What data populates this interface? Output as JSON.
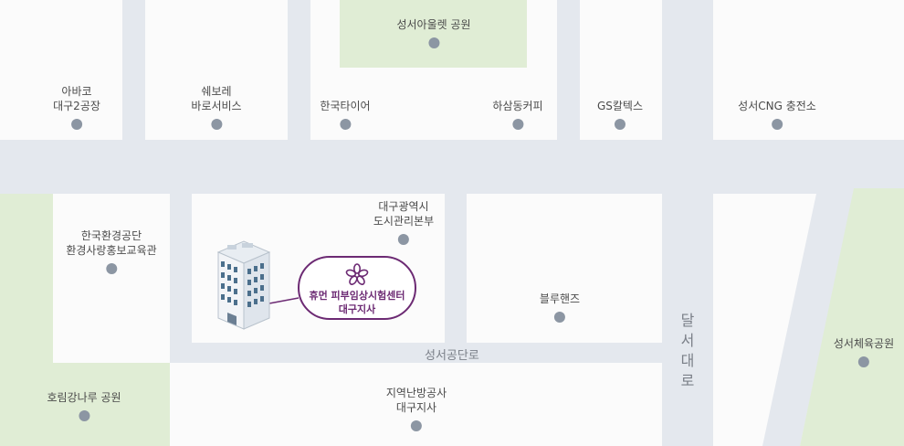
{
  "parks": {
    "seongseo_outlet": "성서아울렛 공원",
    "horimgangnaru": "호림강나루 공원",
    "seongseo_sports": "성서체육공원"
  },
  "poi": {
    "abaco": [
      "아바코",
      "대구2공장"
    ],
    "chevrolet": [
      "쉐보레",
      "바로서비스"
    ],
    "hankook_tire": "한국타이어",
    "hasamdong_coffee": "하삼동커피",
    "gs_caltex": "GS칼텍스",
    "seongseo_cng": "성서CNG 충전소",
    "korea_env": [
      "한국환경공단",
      "환경사랑홍보교육관"
    ],
    "daegu_facility": [
      "대구광역시",
      "도시관리본부"
    ],
    "bluehands": "블루핸즈",
    "district_heating": [
      "지역난방공사",
      "대구지사"
    ]
  },
  "roads": {
    "seongseo_gongdan_ro": "성서공단로",
    "dalseo_daero": [
      "달",
      "서",
      "대",
      "로"
    ]
  },
  "destination": {
    "name_line1": "휴먼 피부임상시험센터",
    "name_line2": "대구지사"
  },
  "colors": {
    "road": "#e4e8ee",
    "block": "#fbfbfb",
    "park": "#e0edd5",
    "poi_dot": "#8c96a3",
    "accent": "#6c2a73"
  }
}
